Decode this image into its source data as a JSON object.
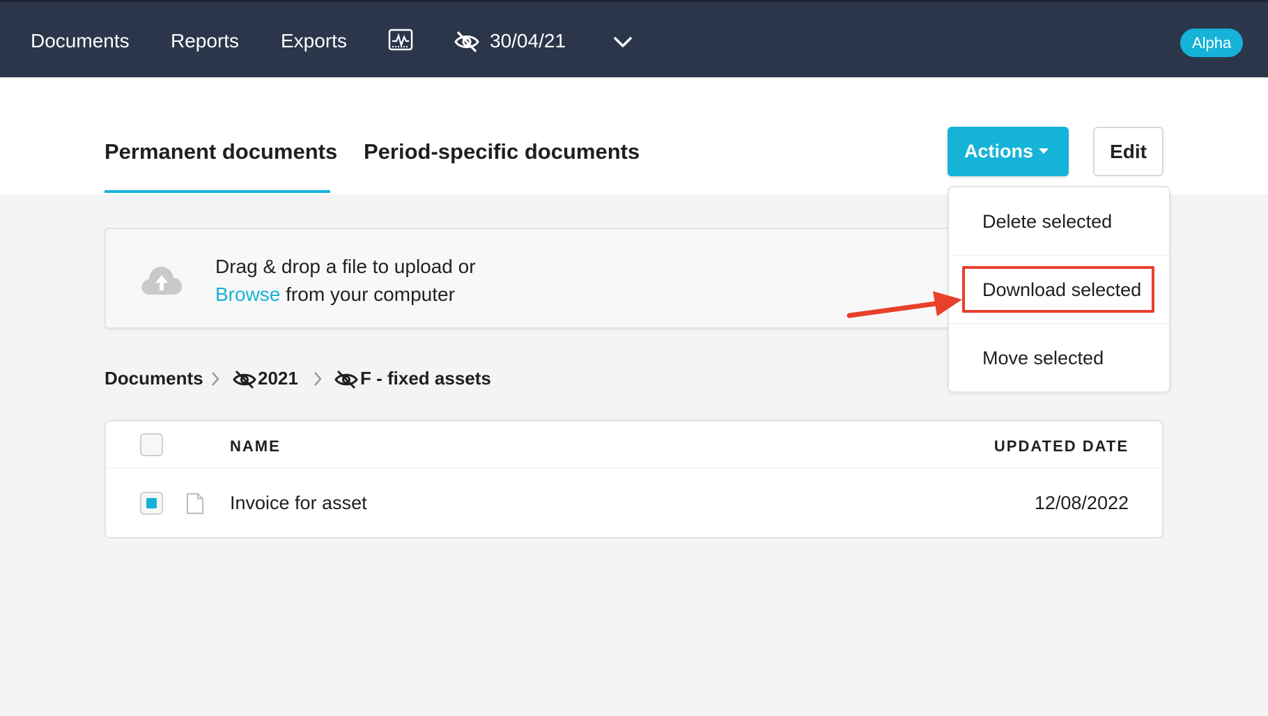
{
  "topnav": {
    "items": [
      "Documents",
      "Reports",
      "Exports"
    ],
    "date": "30/04/21",
    "badge": "Alpha",
    "icons": [
      "monitor-chart-icon",
      "eye-off-icon",
      "chevron-down-icon"
    ]
  },
  "tabs": [
    {
      "label": "Permanent documents",
      "active": true
    },
    {
      "label": "Period-specific documents",
      "active": false
    }
  ],
  "actions": {
    "actions_label": "Actions",
    "edit_label": "Edit",
    "menu": [
      "Delete selected",
      "Download selected",
      "Move selected"
    ],
    "highlighted_item": "Download selected"
  },
  "upload": {
    "line1": "Drag & drop a file to upload or",
    "browse": "Browse",
    "line2_rest": " from your computer"
  },
  "breadcrumb": [
    "Documents",
    "2021",
    "F - fixed assets"
  ],
  "table": {
    "headers": {
      "name": "NAME",
      "updated": "UPDATED DATE"
    },
    "rows": [
      {
        "name": "Invoice for asset",
        "updated": "12/08/2022",
        "selected": true
      }
    ]
  },
  "colors": {
    "nav_bg": "#2b364b",
    "accent": "#16b3d8",
    "annotation": "#e8402a"
  }
}
